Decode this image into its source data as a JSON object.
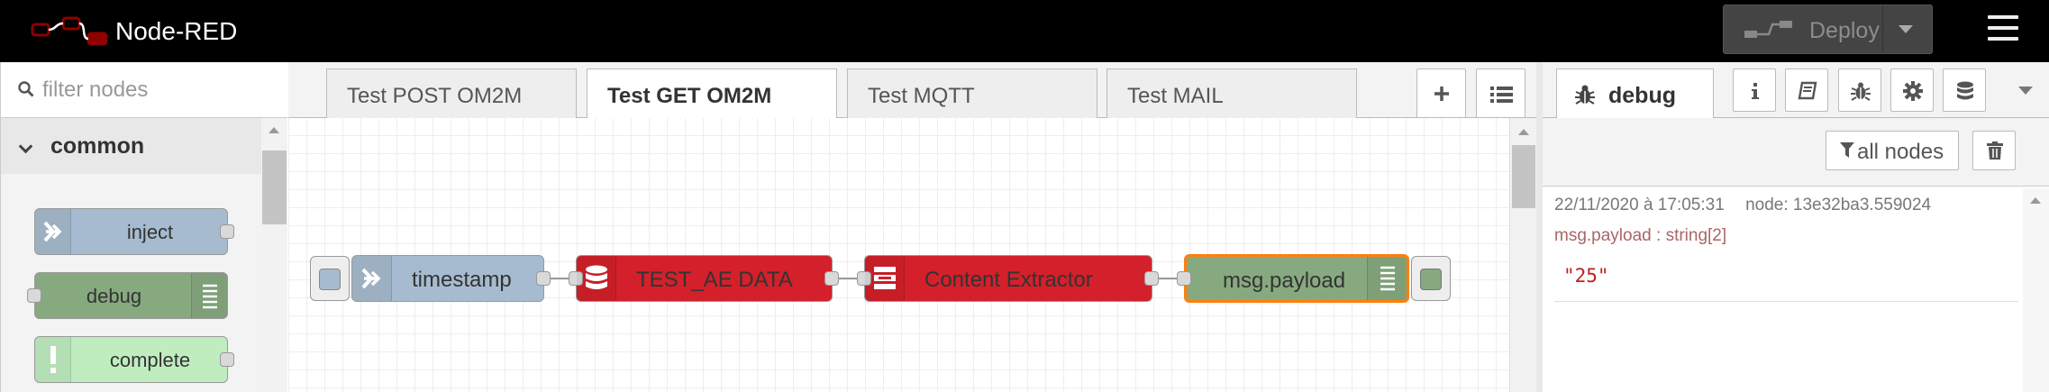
{
  "header": {
    "title": "Node-RED",
    "deploy_label": "Deploy",
    "logo_icon": "node-red-logo-icon",
    "menu_icon": "hamburger-menu-icon"
  },
  "palette": {
    "search_placeholder": "filter nodes",
    "category": "common",
    "nodes": [
      {
        "label": "inject",
        "color": "#a6bbcf",
        "icon": "inject-arrow-icon"
      },
      {
        "label": "debug",
        "color": "#87a980",
        "icon": "debug-list-icon"
      },
      {
        "label": "complete",
        "color": "#c0edc0",
        "icon": "exclamation-icon"
      }
    ]
  },
  "workspace": {
    "tabs": [
      {
        "label": "Test POST OM2M",
        "active": false
      },
      {
        "label": "Test GET OM2M",
        "active": true
      },
      {
        "label": "Test MQTT",
        "active": false
      },
      {
        "label": "Test MAIL",
        "active": false
      }
    ],
    "add_tab_icon": "plus-icon",
    "list_tabs_icon": "list-icon",
    "flow_nodes": [
      {
        "label": "timestamp",
        "color": "#a6bbcf",
        "icon": "inject-arrow-icon"
      },
      {
        "label": "TEST_AE DATA",
        "color": "#d3202a",
        "icon": "database-icon"
      },
      {
        "label": "Content Extractor",
        "color": "#d3202a",
        "icon": "extractor-icon"
      },
      {
        "label": "msg.payload",
        "color": "#87a980",
        "icon": "debug-list-icon",
        "selected_border": "#ff7f0e"
      }
    ]
  },
  "sidebar": {
    "active_tab": "debug",
    "tab_icons": [
      "info-icon",
      "book-icon",
      "bug-icon",
      "gear-icon",
      "database-icon"
    ],
    "filter_label": "all nodes",
    "message": {
      "date": "22/11/2020 à 17:05:31",
      "node": "node: 13e32ba3.559024",
      "topic": "msg.payload : string[2]",
      "value": "\"25\""
    }
  }
}
